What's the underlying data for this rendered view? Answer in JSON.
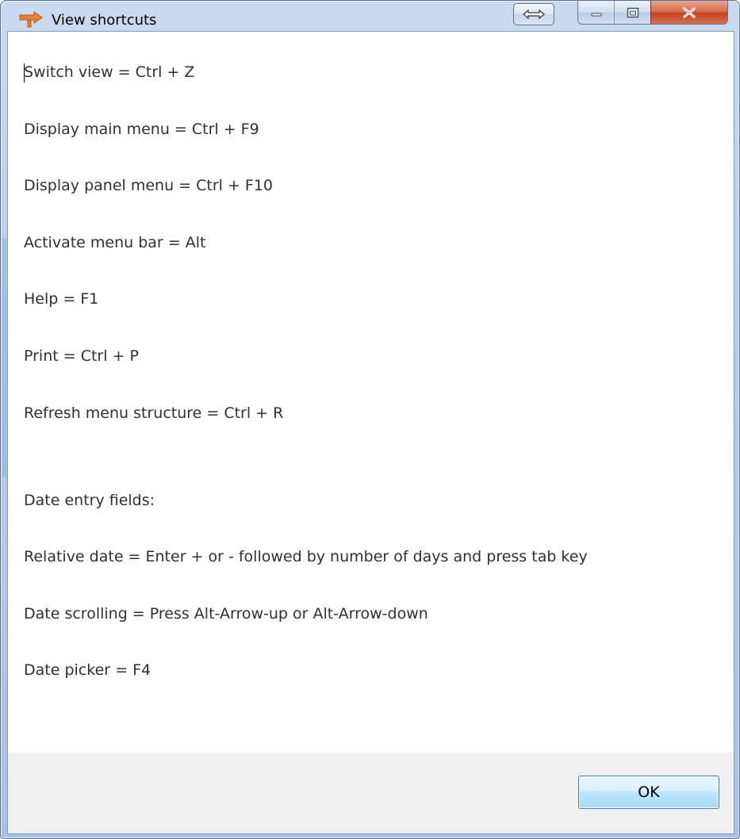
{
  "window": {
    "title": "View shortcuts",
    "ok_label": "OK"
  },
  "shortcuts": [
    "Switch view = Ctrl + Z",
    "Display main menu = Ctrl + F9",
    "Display panel menu = Ctrl + F10",
    "Activate menu bar = Alt",
    "Help = F1",
    "Print = Ctrl + P",
    "Refresh menu structure = Ctrl + R",
    "Date entry fields:",
    "Relative date = Enter + or - followed by number of days and press tab key",
    "Date scrolling = Press Alt-Arrow-up or Alt-Arrow-down",
    "Date picker = F4"
  ],
  "icons": {
    "app": "orange-arrow-icon",
    "resize": "double-arrow-icon",
    "minimize": "minimize-icon",
    "maximize": "maximize-icon",
    "close": "close-icon"
  },
  "colors": {
    "close_button": "#c7431f",
    "ok_border": "#3c7fb1",
    "footer_bg": "#f0f0f0"
  }
}
